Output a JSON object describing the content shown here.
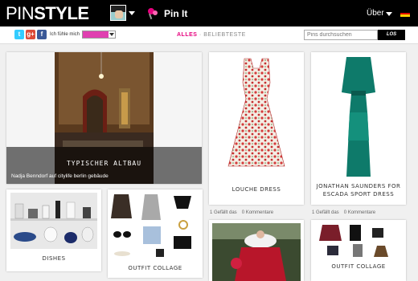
{
  "header": {
    "logo_thin": "PIN",
    "logo_bold": "STYLE",
    "pin_it": "Pin It",
    "about": "Über",
    "flag_colors": [
      "#000000",
      "#dd0000",
      "#ffce00"
    ]
  },
  "subbar": {
    "social": [
      {
        "icon": "twitter-icon",
        "glyph": "t",
        "color": "#33ccff"
      },
      {
        "icon": "googleplus-icon",
        "glyph": "g+",
        "color": "#dd4b39"
      },
      {
        "icon": "facebook-icon",
        "glyph": "f",
        "color": "#3b5998"
      }
    ],
    "feel_label": "Ich fühle mich",
    "filter_all": "ALLES",
    "filter_sep": "·",
    "filter_popular": "BELIEBTESTE",
    "search_placeholder": "Pins durchsuchen",
    "search_button": "LOS"
  },
  "pins": {
    "altbau": {
      "title": "TYPISCHER ALTBAU",
      "subtitle": "Nadja Benndorf auf citylife berlin gebäude"
    },
    "dress1": {
      "title": "LOUCHE DRESS",
      "likes": "1 Gefällt das",
      "comments": "0 Kommentare"
    },
    "dress2": {
      "title": "JONATHAN SAUNDERS FOR ESCADA SPORT DRESS",
      "likes": "1 Gefällt das",
      "comments": "0 Kommentare"
    },
    "dishes": {
      "title": "DISHES"
    },
    "outfit1": {
      "title": "OUTFIT COLLAGE"
    },
    "outfit2": {
      "title": "OUTFIT COLLAGE"
    }
  },
  "colors": {
    "accent": "#e6007e"
  }
}
